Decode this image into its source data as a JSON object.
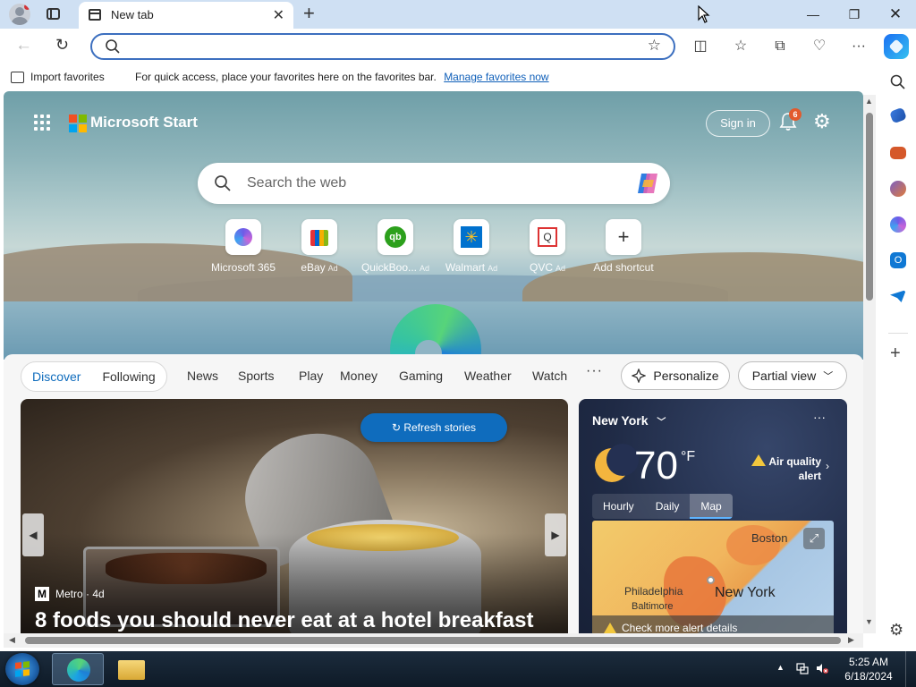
{
  "browser": {
    "tab_title": "New tab",
    "address_value": "",
    "favorites_bar": {
      "import_label": "Import favorites",
      "message": "For quick access, place your favorites here on the favorites bar.",
      "manage_link": "Manage favorites now"
    }
  },
  "start_page": {
    "brand": "Microsoft Start",
    "sign_in": "Sign in",
    "notification_count": "6",
    "search_placeholder": "Search the web",
    "shortcuts": [
      {
        "label": "Microsoft 365",
        "ad": ""
      },
      {
        "label": "eBay",
        "ad": "Ad"
      },
      {
        "label": "QuickBoo...",
        "ad": "Ad"
      },
      {
        "label": "Walmart",
        "ad": "Ad"
      },
      {
        "label": "QVC",
        "ad": "Ad"
      },
      {
        "label": "Add shortcut",
        "ad": ""
      }
    ]
  },
  "feed_nav": {
    "segments": [
      "Discover",
      "Following"
    ],
    "items": [
      "News",
      "Sports",
      "Play",
      "Money",
      "Gaming",
      "Weather",
      "Watch"
    ],
    "more": "···",
    "personalize": "Personalize",
    "view": "Partial view"
  },
  "story": {
    "refresh": "Refresh stories",
    "source": "Metro · 4d",
    "source_logo": "M",
    "title": "8 foods you should never eat at a hotel breakfast"
  },
  "weather": {
    "city": "New York",
    "temp": "70",
    "unit": "°F",
    "alert_line1": "Air quality",
    "alert_line2": "alert",
    "tabs": [
      "Hourly",
      "Daily",
      "Map"
    ],
    "active_tab": "Map",
    "map_labels": {
      "boston": "Boston",
      "philadelphia": "Philadelphia",
      "baltimore": "Baltimore",
      "new_york": "New York"
    },
    "alert_details": "Check more alert details"
  },
  "taskbar": {
    "time": "5:25 AM",
    "date": "6/18/2024"
  },
  "colors": {
    "accent": "#0f6cbd",
    "titlebar": "#cfe0f3",
    "alert_yellow": "#f2c73d"
  }
}
